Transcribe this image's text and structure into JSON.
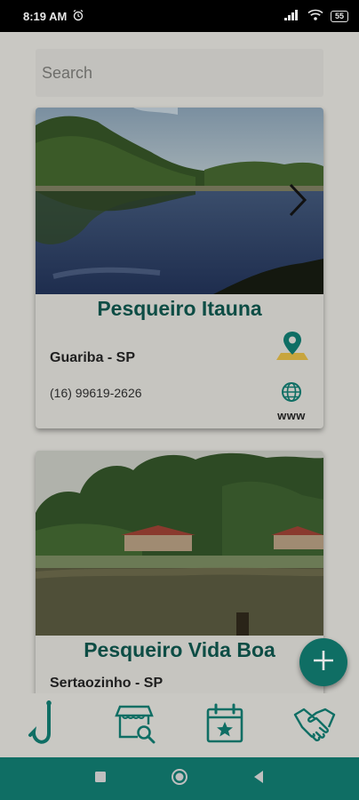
{
  "status_bar": {
    "time": "8:19 AM",
    "battery": "55"
  },
  "search": {
    "placeholder": "Search"
  },
  "cards": [
    {
      "title": "Pesqueiro Itauna",
      "city": "Guariba - SP",
      "phone": "(16) 99619-2626",
      "web_label": "www"
    },
    {
      "title": "Pesqueiro Vida Boa",
      "city": "Sertaozinho - SP"
    }
  ],
  "icons": {
    "status": [
      "alarm-icon",
      "signal-icon",
      "wifi-icon",
      "battery-icon"
    ],
    "card": [
      "map-pin-icon",
      "globe-icon",
      "chevron-right-icon"
    ],
    "fab": "plus-icon",
    "nav": [
      "fishing-hook-icon",
      "store-search-icon",
      "calendar-star-icon",
      "handshake-icon"
    ],
    "system": [
      "recents-square-icon",
      "home-circle-icon",
      "back-triangle-icon"
    ]
  },
  "colors": {
    "accent": "#0f6e64",
    "title": "#0d4d45",
    "background": "#c9c8c3"
  }
}
